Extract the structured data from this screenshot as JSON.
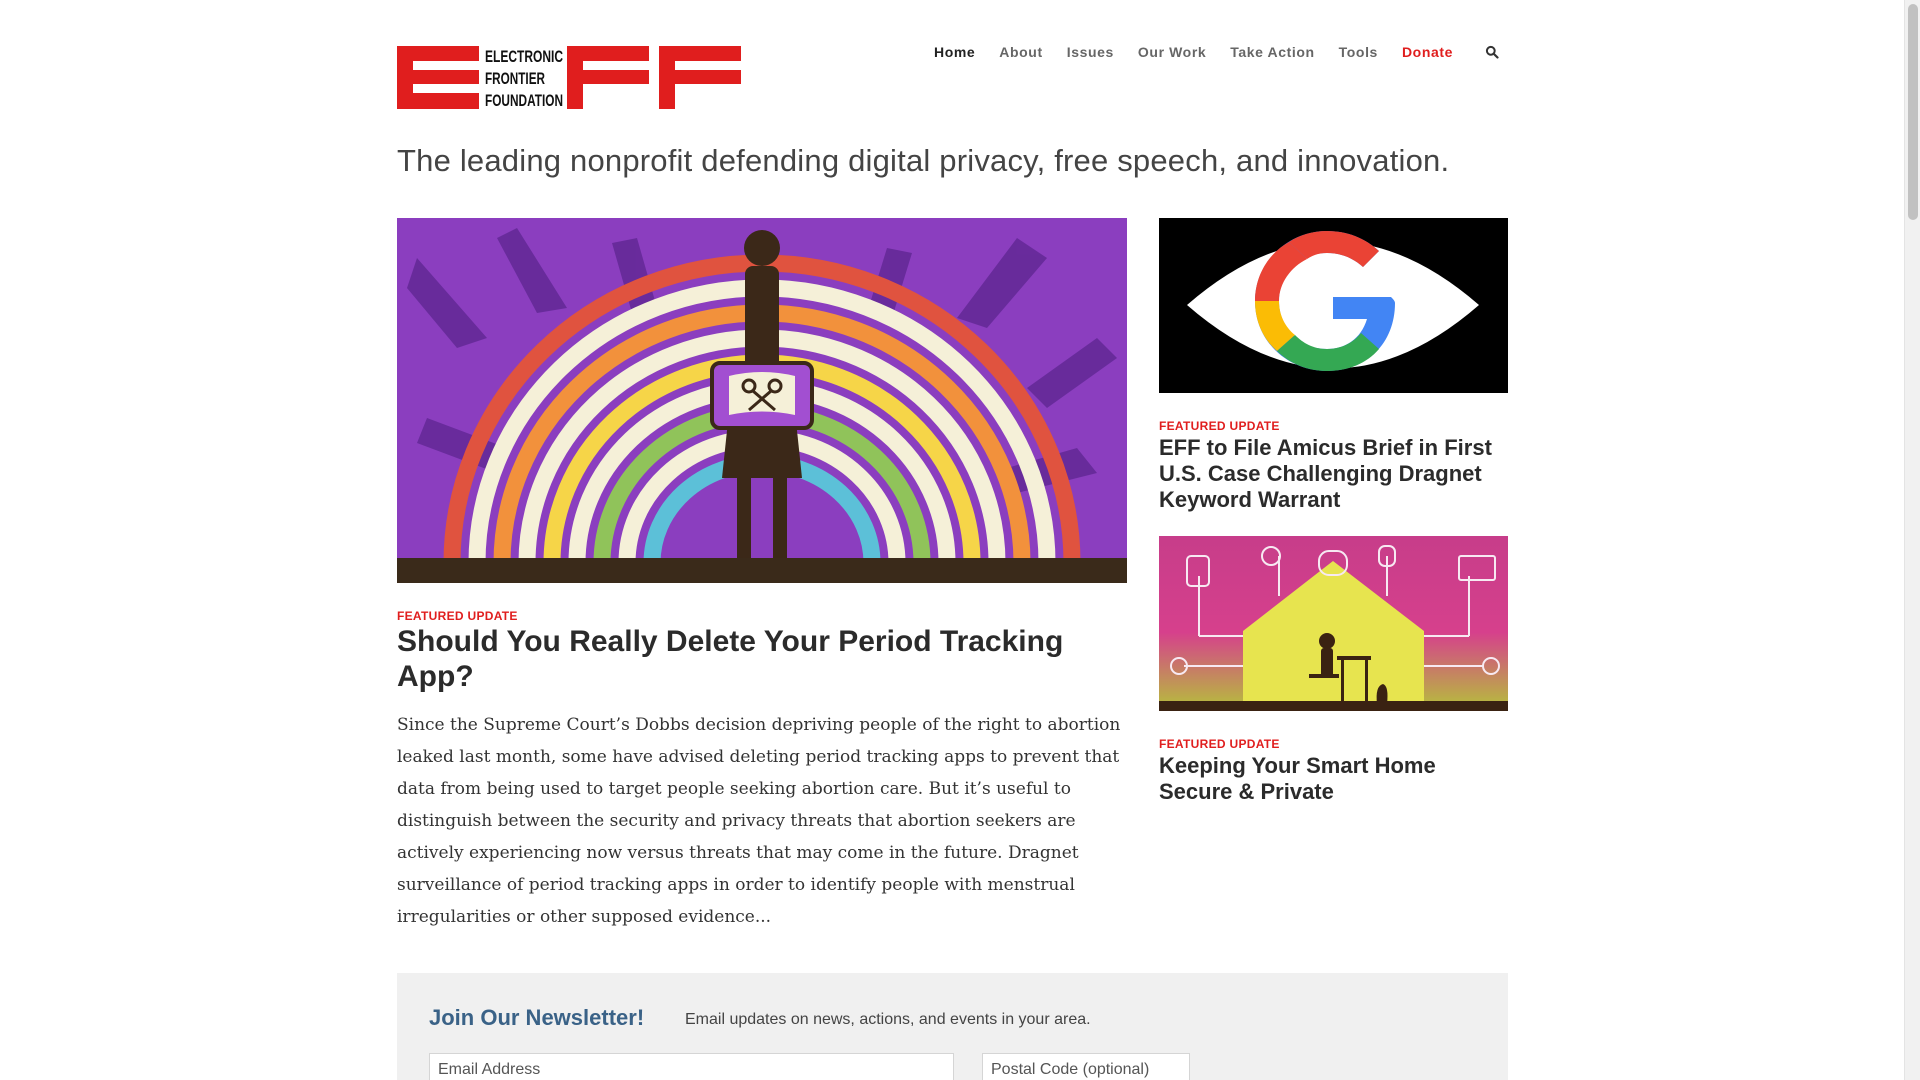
{
  "header": {
    "logo_text": "ELECTRONIC FRONTIER FOUNDATION",
    "nav": [
      {
        "label": "Home",
        "state": "active"
      },
      {
        "label": "About"
      },
      {
        "label": "Issues"
      },
      {
        "label": "Our Work"
      },
      {
        "label": "Take Action"
      },
      {
        "label": "Tools"
      },
      {
        "label": "Donate",
        "color": "#e01e1e"
      }
    ],
    "search_icon": "search-icon"
  },
  "tagline": "The leading nonprofit defending digital privacy, free speech, and innovation.",
  "main_feature": {
    "kicker": "FEATURED UPDATE",
    "title": "Should You Really Delete Your Period Tracking App?",
    "excerpt": "Since the Supreme Court’s Dobbs decision depriving people of the right to abortion leaked last month, some have advised deleting period tracking apps to prevent that data from being used to target people seeking abortion care. But it’s useful to distinguish between the security and privacy threats that abortion seekers are actively experiencing now versus threats that may come in the future. Dragnet surveillance of period tracking apps in order to identify people with menstrual irregularities or other supposed evidence..."
  },
  "side_features": [
    {
      "kicker": "FEATURED UPDATE",
      "title": "EFF to File Amicus Brief in First U.S. Case Challenging Dragnet Keyword Warrant"
    },
    {
      "kicker": "FEATURED UPDATE",
      "title": "Keeping Your Smart Home Secure & Private"
    }
  ],
  "newsletter": {
    "title": "Join Our Newsletter!",
    "subtitle": "Email updates on news, actions, and events in your area.",
    "email_placeholder": "Email Address",
    "postal_placeholder": "Postal Code (optional)"
  },
  "colors": {
    "brand_red": "#e01e1e",
    "newsletter_title": "#3a6287"
  }
}
